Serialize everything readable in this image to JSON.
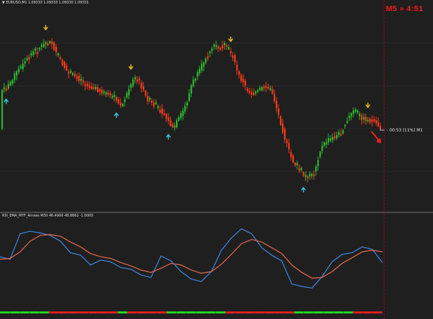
{
  "chart": {
    "title": "EURUSD,M1  1.09333 1.09333 1.09330 1.09331",
    "timer": "M5 » 4:51",
    "countdown": "- 00:53 (11%) M1"
  },
  "indicator": {
    "title": "RSI_EMA_MTF_Arrows M30 46.4900 48.8862 -1.0000"
  },
  "colors": {
    "background": "#1f1f1f",
    "bull_candle": "#2fb82f",
    "bear_candle": "#ff3a1a",
    "arrow_up": "#37c8e6",
    "arrow_down": "#f0c020",
    "rsi_line": "#3f8be8",
    "ema_line": "#f06a50",
    "bar_green": "#22d622",
    "bar_red": "#e01e1e"
  },
  "chart_data": [
    {
      "type": "candlestick",
      "symbol": "EURUSD",
      "timeframe": "M1",
      "last_bar": {
        "open": 1.09333,
        "high": 1.09333,
        "low": 1.0933,
        "close": 1.09331
      },
      "signals": [
        {
          "bar": 2,
          "type": "buy"
        },
        {
          "bar": 21,
          "type": "sell"
        },
        {
          "bar": 55,
          "type": "buy"
        },
        {
          "bar": 62,
          "type": "sell"
        },
        {
          "bar": 80,
          "type": "buy"
        },
        {
          "bar": 110,
          "type": "sell"
        },
        {
          "bar": 145,
          "type": "buy"
        },
        {
          "bar": 176,
          "type": "sell"
        }
      ]
    },
    {
      "type": "line",
      "title": "RSI_EMA_MTF_Arrows M30 46.4900 48.8862 -1.0000",
      "series": [
        {
          "values": [
            52,
            49,
            80,
            83,
            81,
            78,
            71,
            57,
            54,
            42,
            48,
            46,
            39,
            37,
            30,
            27,
            53,
            47,
            34,
            25,
            22,
            34,
            60,
            75,
            86,
            80,
            63,
            54,
            47,
            19,
            16,
            14,
            28,
            46,
            55,
            57,
            64,
            61,
            45
          ]
        },
        {
          "values": [
            49,
            50,
            58,
            71,
            78,
            79,
            77,
            70,
            64,
            56,
            52,
            50,
            45,
            41,
            36,
            33,
            38,
            44,
            42,
            36,
            32,
            34,
            43,
            55,
            68,
            73,
            70,
            63,
            56,
            42,
            33,
            26,
            27,
            34,
            44,
            51,
            58,
            60,
            58
          ]
        }
      ],
      "state_bars": [
        "green",
        "green",
        "green",
        "green",
        "green",
        "red",
        "red",
        "red",
        "red",
        "red",
        "red",
        "red",
        "green",
        "red",
        "red",
        "red",
        "red",
        "green",
        "green",
        "green",
        "green",
        "green",
        "green",
        "red",
        "red",
        "red",
        "red",
        "red",
        "red",
        "red",
        "green",
        "green",
        "green",
        "green",
        "green",
        "green",
        "red",
        "red",
        "red"
      ]
    }
  ]
}
